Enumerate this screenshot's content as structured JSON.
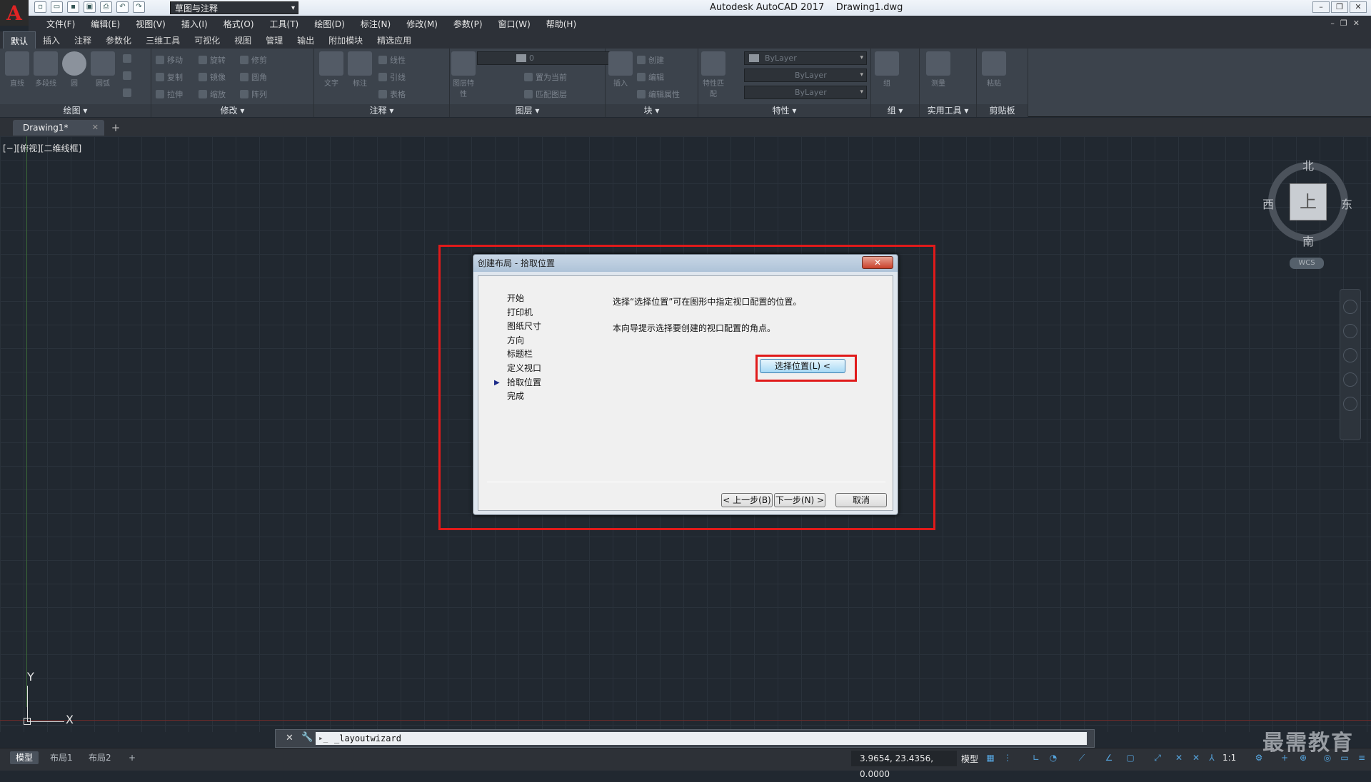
{
  "app": {
    "title": "Autodesk AutoCAD 2017",
    "document": "Drawing1.dwg",
    "logo_letter": "A",
    "workspace": "草图与注释"
  },
  "menu": [
    "文件(F)",
    "编辑(E)",
    "视图(V)",
    "插入(I)",
    "格式(O)",
    "工具(T)",
    "绘图(D)",
    "标注(N)",
    "修改(M)",
    "参数(P)",
    "窗口(W)",
    "帮助(H)"
  ],
  "ribbon_tabs": [
    "默认",
    "插入",
    "注释",
    "参数化",
    "三维工具",
    "可视化",
    "视图",
    "管理",
    "输出",
    "附加模块",
    "精选应用"
  ],
  "ribbon": {
    "panels": [
      "绘图",
      "修改",
      "注释",
      "图层",
      "块",
      "特性",
      "组",
      "实用工具",
      "剪贴板"
    ],
    "draw_tools": [
      "直线",
      "多段线",
      "圆",
      "圆弧"
    ],
    "modify_tools": [
      "移动",
      "旋转",
      "修剪",
      "复制",
      "镜像",
      "圆角",
      "拉伸",
      "缩放",
      "阵列"
    ],
    "annotation_tools": [
      "文字",
      "标注",
      "线性",
      "引线",
      "表格"
    ],
    "layer_tools": [
      "图层特性",
      "置为当前",
      "匹配图层"
    ],
    "layer_name": "0",
    "block_tools": [
      "插入",
      "创建",
      "编辑",
      "编辑属性"
    ],
    "property_tools": [
      "特性匹配"
    ],
    "property_values": [
      "ByLayer",
      "ByLayer",
      "ByLayer"
    ],
    "group_tools": [
      "组"
    ],
    "util_tools": [
      "测量"
    ],
    "clipboard_tools": [
      "粘贴"
    ]
  },
  "doc_tab": {
    "name": "Drawing1*"
  },
  "viewport_label": "[−][俯视][二维线框]",
  "ucs": {
    "x": "X",
    "y": "Y"
  },
  "viewcube": {
    "north": "北",
    "south": "南",
    "west": "西",
    "east": "东",
    "face": "上",
    "wcs": "WCS"
  },
  "dialog": {
    "title": "创建布局 - 拾取位置",
    "close": "✕",
    "steps": [
      "开始",
      "打印机",
      "图纸尺寸",
      "方向",
      "标题栏",
      "定义视口",
      "拾取位置",
      "完成"
    ],
    "current_step": "拾取位置",
    "desc1": "选择“选择位置”可在图形中指定视口配置的位置。",
    "desc2": "本向导提示选择要创建的视口配置的角点。",
    "pick_button": "选择位置(L) <",
    "back": "< 上一步(B)",
    "next": "下一步(N) >",
    "cancel": "取消"
  },
  "command": {
    "text": "_layoutwizard",
    "prompt": "▸_"
  },
  "layout_tabs": [
    "模型",
    "布局1",
    "布局2"
  ],
  "status": {
    "coords": "3.9654, 23.4356, 0.0000",
    "model": "模型",
    "scale": "1:1"
  },
  "watermark": "最需教育"
}
